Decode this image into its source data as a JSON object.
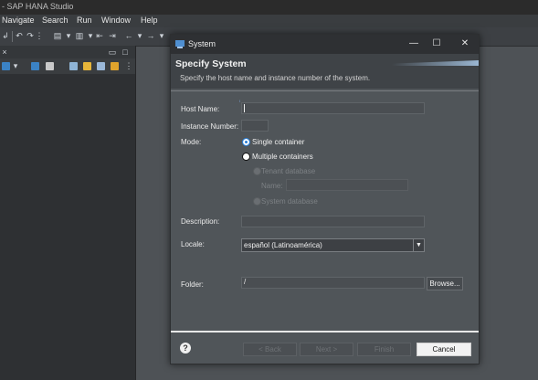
{
  "window": {
    "title": "- SAP HANA Studio"
  },
  "menu": [
    {
      "label": "Navigate"
    },
    {
      "label": "Search"
    },
    {
      "label": "Run"
    },
    {
      "label": "Window"
    },
    {
      "label": "Help"
    }
  ],
  "dialog": {
    "title": "System",
    "banner_title": "Specify System",
    "banner_subtitle": "Specify the host name and instance number of the system.",
    "host_label": "Host Name:",
    "host_value": "",
    "instance_label": "Instance Number:",
    "instance_value": "",
    "mode_label": "Mode:",
    "mode_single": "Single container",
    "mode_multiple": "Multiple containers",
    "tenant_db": "Tenant database",
    "name_label": "Name:",
    "system_db": "System database",
    "description_label": "Description:",
    "description_value": "",
    "locale_label": "Locale:",
    "locale_value": "español (Latinoamérica)",
    "folder_label": "Folder:",
    "folder_value": "/",
    "browse_label": "Browse...",
    "back_label": "< Back",
    "next_label": "Next >",
    "finish_label": "Finish",
    "cancel_label": "Cancel",
    "help_symbol": "?"
  },
  "icons": {
    "close": "close-icon",
    "maximize": "maximize-icon",
    "minimize": "minimize-icon",
    "dropdown": "chevron-down-icon"
  },
  "colors": {
    "accent_blue": "#2a7fd8",
    "dialog_bg": "#505559",
    "banner_bg": "#3f4347"
  }
}
